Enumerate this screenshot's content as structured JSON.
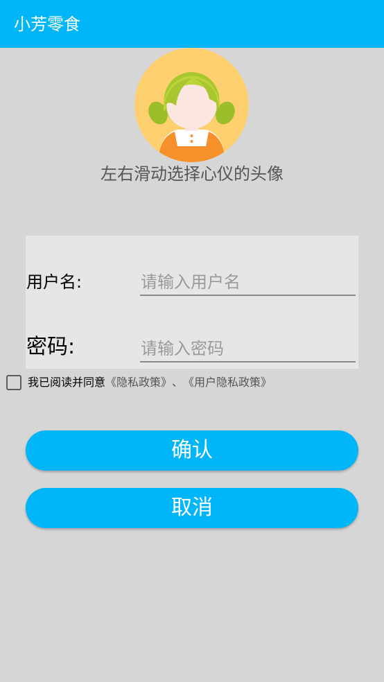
{
  "app_bar": {
    "title": "小芳零食",
    "background": "#00b5f8"
  },
  "avatar": {
    "icon": "girl-avatar-icon",
    "hint": "左右滑动选择心仪的头像"
  },
  "form": {
    "username_label": "用户名:",
    "username_placeholder": "请输入用户名",
    "username_value": "",
    "password_label": "密码:",
    "password_placeholder": "请输入密码",
    "password_value": ""
  },
  "agreement": {
    "checked": false,
    "prefix": "我已阅读并同意",
    "privacy_policy": "《隐私政策》",
    "separator": "、",
    "user_privacy_policy": "《用户隐私政策》"
  },
  "actions": {
    "confirm_label": "确认",
    "cancel_label": "取消"
  }
}
